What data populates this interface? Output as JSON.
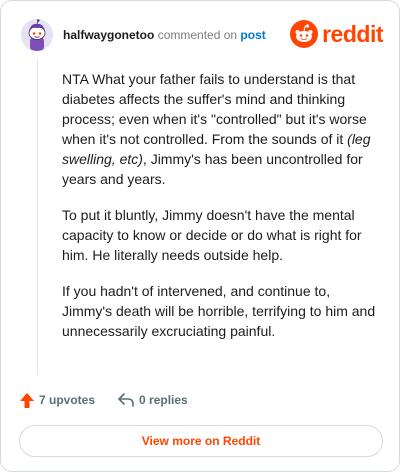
{
  "header": {
    "username": "halfwaygonetoo",
    "action_text": "commented on",
    "post_link": "post",
    "brand": "reddit",
    "avatar_icon": "snoo-avatar-icon",
    "logo_icon": "reddit-snoo-icon"
  },
  "comment": {
    "paragraphs": [
      {
        "before": "NTA What your father fails to understand is that diabetes affects the suffer's mind and thinking process; even when it's \"controlled\" but it's worse when it's not controlled. From the sounds of it ",
        "emphasis": "(leg swelling, etc)",
        "after": ", Jimmy's has been uncontrolled for years and years."
      },
      "To put it bluntly, Jimmy doesn't have the mental capacity to know or decide or do what is right for him. He literally needs outside help.",
      "If you hadn't of intervened, and continue to, Jimmy's death will be horrible, terrifying to him and unnecessarily excruciating painful."
    ]
  },
  "actions": {
    "upvotes": "7 upvotes",
    "replies": "0 replies",
    "upvote_icon": "upvote-arrow-icon",
    "reply_icon": "reply-arrow-icon"
  },
  "cta": {
    "label": "View more on Reddit"
  },
  "colors": {
    "brand": "#ff4500",
    "link": "#0079d3",
    "muted": "#576f76"
  }
}
